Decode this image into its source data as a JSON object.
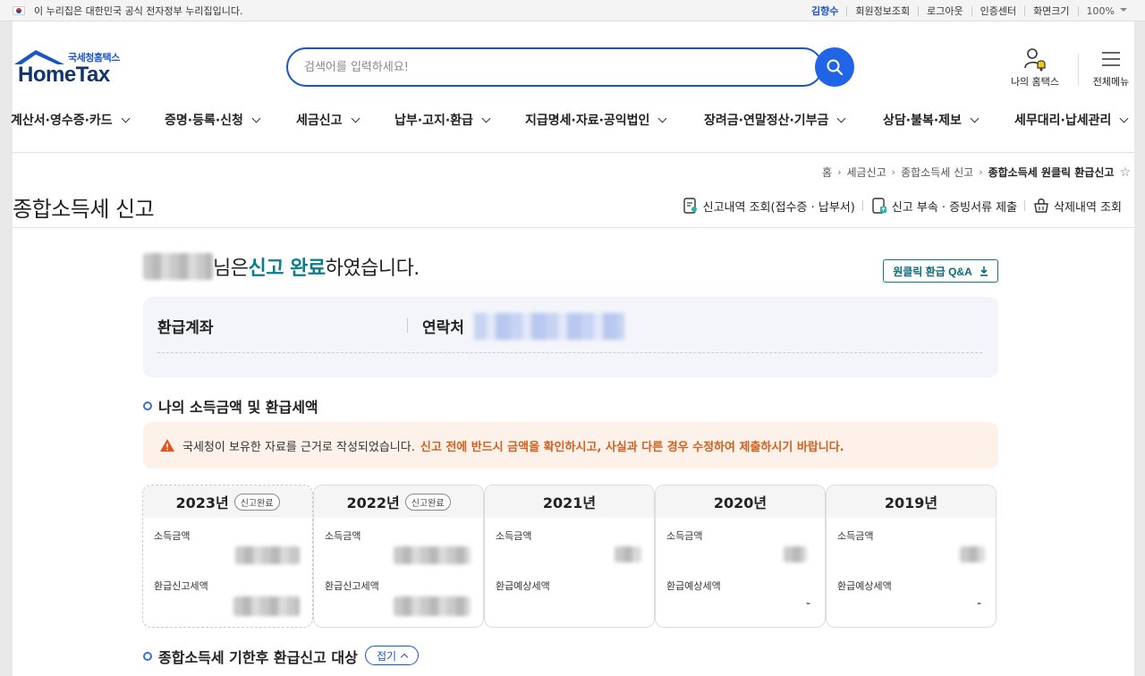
{
  "gov_banner": {
    "text": "이 누리집은 대한민국 공식 전자정부 누리집입니다."
  },
  "util_menu": {
    "user": "김향수",
    "member_info": "회원정보조회",
    "logout": "로그아웃",
    "cert_center": "인증센터",
    "screen_size": "화면크기",
    "zoom": "100%"
  },
  "logo": {
    "sub": "국세청홈택스",
    "main": "HomeTax"
  },
  "search": {
    "placeholder": "검색어를 입력하세요!"
  },
  "header_links": {
    "my_hometax": "나의 홈택스",
    "all_menu": "전체메뉴"
  },
  "gnb": [
    "계산서·영수증·카드",
    "증명·등록·신청",
    "세금신고",
    "납부·고지·환급",
    "지급명세·자료·공익법인",
    "장려금·연말정산·기부금",
    "상담·불복·제보",
    "세무대리·납세관리"
  ],
  "breadcrumb": {
    "home": "홈",
    "level1": "세금신고",
    "level2": "종합소득세 신고",
    "current": "종합소득세 원클릭 환급신고"
  },
  "page": {
    "title": "종합소득세 신고",
    "actions": [
      "신고내역 조회(접수증 · 납부서)",
      "신고 부속 · 증빙서류 제출",
      "삭제내역 조회"
    ]
  },
  "completion": {
    "suffix_name": "님은 ",
    "highlight": "신고 완료",
    "tail": "하였습니다."
  },
  "qa_button": "원클릭 환급 Q&A",
  "account": {
    "refund_account_label": "환급계좌",
    "contact_label": "연락처"
  },
  "section_income": "나의 소득금액 및 환급세액",
  "notice": {
    "text": "국세청이 보유한 자료를 근거로 작성되었습니다.",
    "highlight": "신고 전에 반드시 금액을 확인하시고, 사실과 다른 경우 수정하여 제출하시기 바랍니다."
  },
  "years": [
    {
      "year": "2023년",
      "badge": "신고완료",
      "income_label": "소득금액",
      "tax_label": "환급신고세액",
      "tax_value": ""
    },
    {
      "year": "2022년",
      "badge": "신고완료",
      "income_label": "소득금액",
      "tax_label": "환급신고세액",
      "tax_value": ""
    },
    {
      "year": "2021년",
      "badge": "",
      "income_label": "소득금액",
      "tax_label": "환급예상세액",
      "tax_value": ""
    },
    {
      "year": "2020년",
      "badge": "",
      "income_label": "소득금액",
      "tax_label": "환급예상세액",
      "tax_value": "-"
    },
    {
      "year": "2019년",
      "badge": "",
      "income_label": "소득금액",
      "tax_label": "환급예상세액",
      "tax_value": "-"
    }
  ],
  "section_late": "종합소득세 기한후 환급신고 대상",
  "toggle_label": "접기",
  "colors": {
    "brand_blue": "#1a55c7",
    "teal": "#0a7d8c",
    "warning_orange": "#d0611f"
  }
}
